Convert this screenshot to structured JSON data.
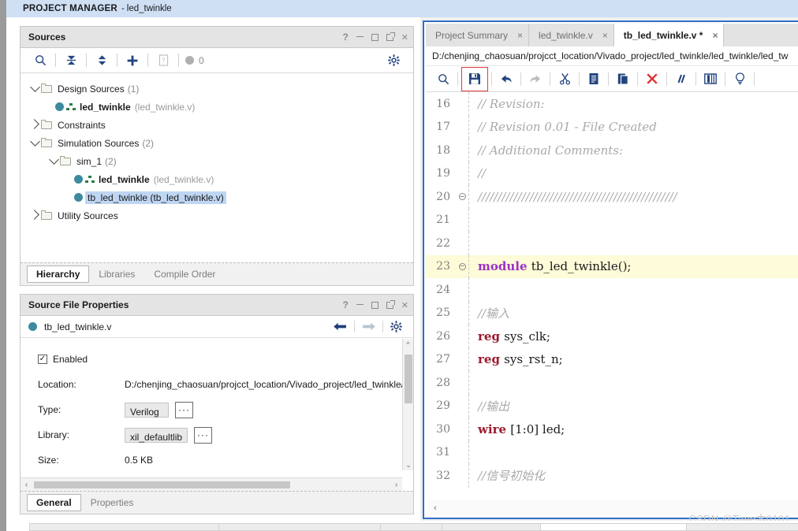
{
  "header": {
    "app_label": "PROJECT MANAGER",
    "separator": "-",
    "project_name": "led_twinkle"
  },
  "sources_panel": {
    "title": "Sources",
    "window_controls": [
      "help",
      "minimize",
      "maximize",
      "float",
      "close"
    ],
    "toolbar": {
      "search_icon": "search-icon",
      "collapse_all_icon": "collapse-all-icon",
      "expand_all_icon": "expand-collapse-icon",
      "add_sources_icon": "plus-icon",
      "report_icon": "report-icon",
      "error_count": "0",
      "settings_icon": "gear-icon"
    },
    "tree": [
      {
        "label": "Design Sources",
        "count": "(1)",
        "expanded": true,
        "indent": 0,
        "kind": "folder"
      },
      {
        "label": "led_twinkle",
        "file": "(led_twinkle.v)",
        "indent": 1,
        "kind": "module",
        "bold": true
      },
      {
        "label": "Constraints",
        "count": "",
        "expanded": false,
        "indent": 0,
        "kind": "folder"
      },
      {
        "label": "Simulation Sources",
        "count": "(2)",
        "expanded": true,
        "indent": 0,
        "kind": "folder"
      },
      {
        "label": "sim_1",
        "count": "(2)",
        "expanded": true,
        "indent": 1,
        "kind": "folder"
      },
      {
        "label": "led_twinkle",
        "file": "(led_twinkle.v)",
        "indent": 2,
        "kind": "module",
        "bold": true
      },
      {
        "label": "tb_led_twinkle (tb_led_twinkle.v)",
        "indent": 2,
        "kind": "file",
        "selected": true
      },
      {
        "label": "Utility Sources",
        "count": "",
        "expanded": false,
        "indent": 0,
        "kind": "folder"
      }
    ],
    "tabs": [
      {
        "label": "Hierarchy",
        "active": true
      },
      {
        "label": "Libraries",
        "active": false
      },
      {
        "label": "Compile Order",
        "active": false
      }
    ]
  },
  "properties_panel": {
    "title": "Source File Properties",
    "file_name": "tb_led_twinkle.v",
    "back_icon": "back-arrow-icon",
    "forward_icon": "forward-arrow-icon",
    "settings_icon": "gear-icon",
    "enabled_label": "Enabled",
    "enabled_checked": true,
    "fields": [
      {
        "label": "Location:",
        "value": "D:/chenjing_chaosuan/projcct_location/Vivado_project/led_twinkle/le",
        "type": "text"
      },
      {
        "label": "Type:",
        "value": "Verilog",
        "type": "combo",
        "browse": "···"
      },
      {
        "label": "Library:",
        "value": "xil_defaultlib",
        "type": "combo",
        "browse": "···"
      },
      {
        "label": "Size:",
        "value": "0.5 KB",
        "type": "text"
      }
    ],
    "tabs": [
      {
        "label": "General",
        "active": true
      },
      {
        "label": "Properties",
        "active": false
      }
    ]
  },
  "editor": {
    "tabs": [
      {
        "label": "Project Summary",
        "active": false,
        "modified": false
      },
      {
        "label": "led_twinkle.v",
        "active": false,
        "modified": false
      },
      {
        "label": "tb_led_twinkle.v *",
        "active": true,
        "modified": true
      }
    ],
    "close_glyph": "×",
    "file_path": "D:/chenjing_chaosuan/projcct_location/Vivado_project/led_twinkle/led_twinkle/led_tw",
    "toolbar": [
      {
        "name": "search-icon",
        "label": "Find"
      },
      {
        "name": "save-icon",
        "label": "Save File",
        "highlighted": true
      },
      {
        "name": "undo-icon",
        "label": "Undo"
      },
      {
        "name": "redo-icon",
        "label": "Redo",
        "disabled": true
      },
      {
        "name": "cut-icon",
        "label": "Cut"
      },
      {
        "name": "copy-icon",
        "label": "Copy"
      },
      {
        "name": "paste-icon",
        "label": "Paste"
      },
      {
        "name": "delete-icon",
        "label": "Delete",
        "color": "#e03131"
      },
      {
        "name": "comment-icon",
        "label": "Toggle Comment"
      },
      {
        "name": "column-edit-icon",
        "label": "Column Edit"
      },
      {
        "name": "bulb-icon",
        "label": "Hints"
      }
    ],
    "lines": [
      {
        "num": "16",
        "fold": "",
        "highlight": false,
        "tokens": [
          {
            "t": "// Revision:",
            "c": "cmt"
          }
        ]
      },
      {
        "num": "17",
        "fold": "",
        "highlight": false,
        "tokens": [
          {
            "t": "// Revision 0.01 - File Created",
            "c": "cmt"
          }
        ]
      },
      {
        "num": "18",
        "fold": "",
        "highlight": false,
        "tokens": [
          {
            "t": "// Additional Comments:",
            "c": "cmt"
          }
        ]
      },
      {
        "num": "19",
        "fold": "",
        "highlight": false,
        "tokens": [
          {
            "t": "//",
            "c": "cmt"
          }
        ]
      },
      {
        "num": "20",
        "fold": "-",
        "highlight": false,
        "tokens": [
          {
            "t": "//////////////////////////////////////////////////",
            "c": "cmt"
          }
        ]
      },
      {
        "num": "21",
        "fold": "",
        "highlight": false,
        "tokens": [
          {
            "t": "",
            "c": "plain"
          }
        ]
      },
      {
        "num": "22",
        "fold": "",
        "highlight": false,
        "tokens": [
          {
            "t": "",
            "c": "plain"
          }
        ]
      },
      {
        "num": "23",
        "fold": "-",
        "highlight": true,
        "tokens": [
          {
            "t": "module ",
            "c": "kw-mod"
          },
          {
            "t": "tb_led_twinkle();",
            "c": "plain"
          }
        ]
      },
      {
        "num": "24",
        "fold": "",
        "highlight": false,
        "tokens": [
          {
            "t": "",
            "c": "plain"
          }
        ]
      },
      {
        "num": "25",
        "fold": "",
        "highlight": false,
        "tokens": [
          {
            "t": "//输入",
            "c": "cmt"
          }
        ]
      },
      {
        "num": "26",
        "fold": "",
        "highlight": false,
        "tokens": [
          {
            "t": "reg ",
            "c": "kw-red"
          },
          {
            "t": "sys_clk;",
            "c": "plain"
          }
        ]
      },
      {
        "num": "27",
        "fold": "",
        "highlight": false,
        "tokens": [
          {
            "t": "reg ",
            "c": "kw-red"
          },
          {
            "t": "sys_rst_n;",
            "c": "plain"
          }
        ]
      },
      {
        "num": "28",
        "fold": "",
        "highlight": false,
        "tokens": [
          {
            "t": "",
            "c": "plain"
          }
        ]
      },
      {
        "num": "29",
        "fold": "",
        "highlight": false,
        "tokens": [
          {
            "t": "//输出",
            "c": "cmt"
          }
        ]
      },
      {
        "num": "30",
        "fold": "",
        "highlight": false,
        "tokens": [
          {
            "t": "wire ",
            "c": "kw-red"
          },
          {
            "t": "[1:0] led;",
            "c": "plain"
          }
        ]
      },
      {
        "num": "31",
        "fold": "",
        "highlight": false,
        "tokens": [
          {
            "t": "",
            "c": "plain"
          }
        ]
      },
      {
        "num": "32",
        "fold": "",
        "highlight": false,
        "tokens": [
          {
            "t": "//信号初始化",
            "c": "cmt"
          }
        ]
      }
    ]
  },
  "watermark": "CSDN @Time木0101",
  "colors": {
    "header_bg": "#cfe0f5",
    "accent_blue": "#2f6fc4",
    "selection_blue": "#bed6f2",
    "save_highlight": "#e23b3b",
    "keyword_red": "#9c1b2e",
    "keyword_purple": "#9b30c8",
    "comment_gray": "#a9a9a9",
    "highlight_line": "#fdfbd8"
  }
}
